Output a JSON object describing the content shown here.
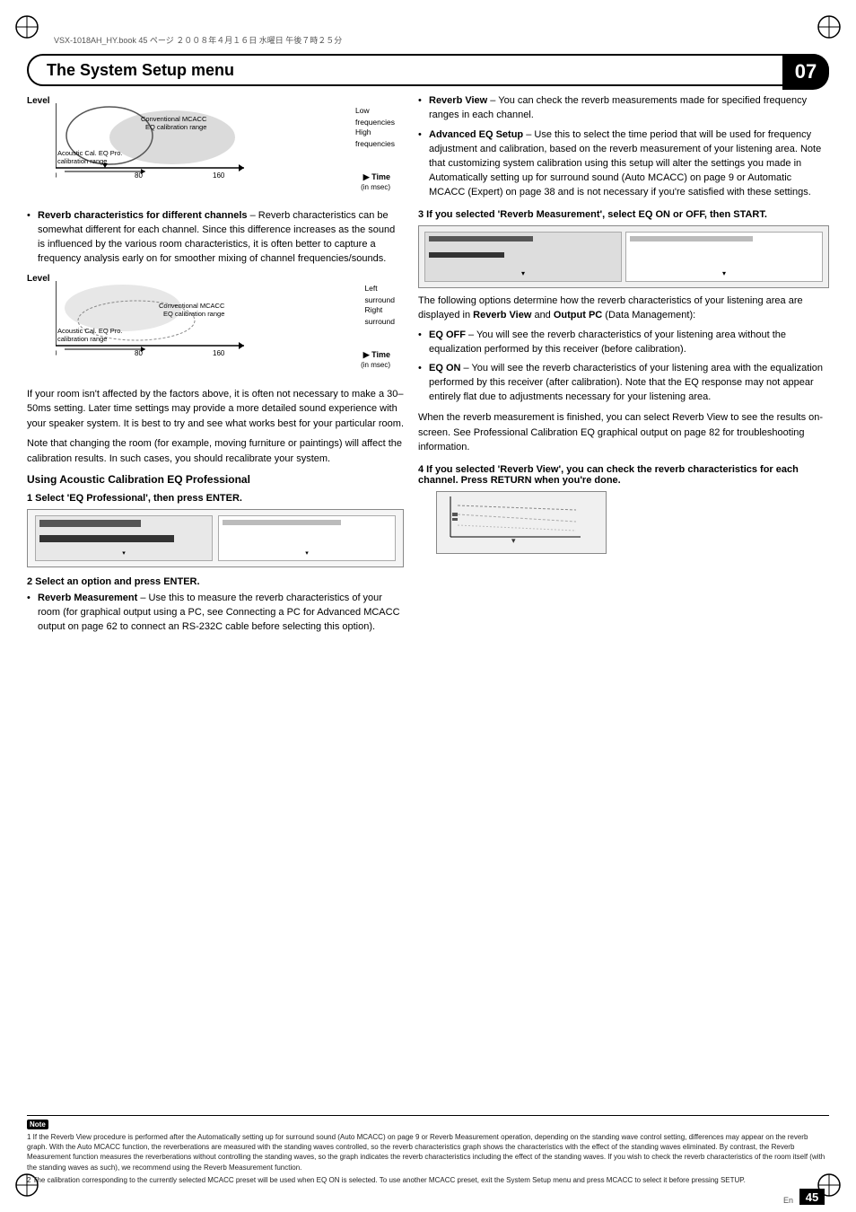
{
  "page": {
    "number": "45",
    "lang": "En",
    "chapter": "07"
  },
  "file_info": "VSX-1018AH_HY.book  45 ページ  ２００８年４月１６日  水曜日  午後７時２５分",
  "header": {
    "title": "The System Setup menu"
  },
  "chart1": {
    "y_label": "Level",
    "x_label": "Time",
    "x_sub": "(in msec)",
    "ticks": [
      "0",
      "80",
      "160"
    ],
    "labels_right": [
      "Low\nfrequencies",
      "High\nfrequencies"
    ],
    "legend": [
      "Acoustic Cal. EQ Pro.\ncalibration range",
      "Conventional MCACC\nEQ calibration range"
    ]
  },
  "chart2": {
    "y_label": "Level",
    "x_label": "Time",
    "x_sub": "(in msec)",
    "ticks": [
      "0",
      "80",
      "160"
    ],
    "labels_right": [
      "Left\nsurround",
      "Right\nsurround"
    ],
    "legend": [
      "Acoustic Cal. EQ Pro.\ncalibration range",
      "Conventional MCACC\nEQ calibration range"
    ]
  },
  "left_col": {
    "bullet1": {
      "heading": "Reverb characteristics for different channels",
      "text": " – Reverb characteristics can be somewhat different for each channel. Since this difference increases as the sound is influenced by the various room characteristics, it is often better to capture a frequency analysis early on for smoother mixing of channel frequencies/sounds."
    },
    "para1": "If your room isn't affected by the factors above, it is often not necessary to make a 30–50ms setting. Later time settings may provide a more detailed sound experience with your speaker system. It is best to try and see what works best for your particular room.",
    "para2": "Note that changing the room (for example, moving furniture or paintings) will affect the calibration results. In such cases, you should recalibrate your system.",
    "section_heading": "Using Acoustic Calibration EQ Professional",
    "step1_heading": "1   Select 'EQ Professional', then press ENTER.",
    "step2_heading": "2   Select an option and press ENTER.",
    "step2_bullet1_heading": "Reverb Measurement",
    "step2_bullet1_text": " – Use this to measure the reverb characteristics of your room (for graphical output using a PC, see Connecting a PC for Advanced MCACC output on page 62 to connect an RS-232C cable before selecting this option)."
  },
  "right_col": {
    "bullet_reverb_view_heading": "Reverb View",
    "bullet_reverb_view_text": " – You can check the reverb measurements made for specified frequency ranges in each channel.",
    "bullet_advanced_eq_heading": "Advanced EQ Setup",
    "bullet_advanced_eq_text": " – Use this to select the time period that will be used for frequency adjustment and calibration, based on the reverb measurement of your listening area. Note that customizing system calibration using this setup will alter the settings you made in Automatically setting up for surround sound (Auto MCACC) on page 9 or Automatic MCACC (Expert) on page 38 and is not necessary if you're satisfied with these settings.",
    "step3_heading": "3   If you selected 'Reverb Measurement', select EQ ON or OFF, then START.",
    "para_following": "The following options determine how the reverb characteristics of your listening area are displayed in",
    "bold1": "Reverb View",
    "and": " and ",
    "bold2": "Output PC",
    "paren": " (Data Management):",
    "eq_off_heading": "EQ OFF",
    "eq_off_text": " – You will see the reverb characteristics of your listening area without the equalization performed by this receiver (before calibration).",
    "eq_on_heading": "EQ ON",
    "eq_on_text": " – You will see the reverb characteristics of your listening area with the equalization performed by this receiver (after calibration).",
    "eq_on_note": " Note that the EQ response may not appear entirely flat due to adjustments necessary for your listening area.",
    "para_when_finished": "When the reverb measurement is finished, you can select Reverb View to see the results on-screen. See Professional Calibration EQ graphical output on page 82 for troubleshooting information.",
    "step4_heading": "4   If you selected 'Reverb View', you can check the reverb characteristics for each channel. Press RETURN when you're done."
  },
  "note": {
    "icon": "Note",
    "line1": "1  If the Reverb View procedure is performed after the Automatically setting up for surround sound (Auto MCACC) on page 9 or Reverb Measurement operation, depending on the standing wave control setting, differences may appear on the reverb graph. With the Auto MCACC function, the reverberations are measured with the standing waves controlled, so the reverb characteristics graph shows the characteristics with the effect of the standing waves eliminated. By contrast, the Reverb Measurement function measures the reverberations without controlling the standing waves, so the graph indicates the reverb characteristics including the effect of the standing waves. If you wish to check the reverb characteristics of the room itself (with the standing waves as such), we recommend using the Reverb Measurement function.",
    "line2": "2  The calibration corresponding to the currently selected MCACC preset will be used when EQ ON is selected. To use another MCACC preset, exit the System Setup menu and press MCACC to select it before pressing SETUP."
  }
}
